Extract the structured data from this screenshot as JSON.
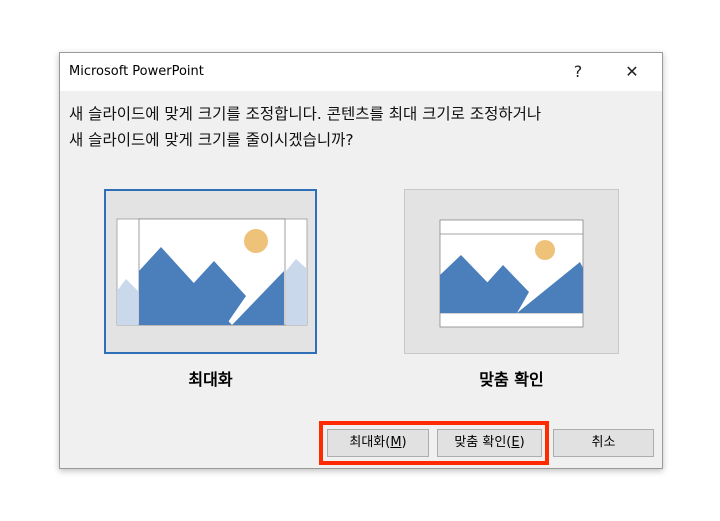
{
  "dialog": {
    "title": "Microsoft PowerPoint",
    "help_label": "?",
    "close_label": "✕",
    "message_line1": "새 슬라이드에 맞게 크기를 조정합니다. 콘텐츠를 최대 크기로 조정하거나",
    "message_line2": "새 슬라이드에 맞게 크기를 줄이시겠습니까?"
  },
  "options": [
    {
      "label": "최대화",
      "selected": true
    },
    {
      "label": "맞춤 확인",
      "selected": false
    }
  ],
  "buttons": {
    "maximize": "최대화(M)",
    "maximize_text": "최대화(",
    "maximize_key": "M",
    "ensure_fit_text": "맞춤 확인(",
    "ensure_fit_key": "E",
    "ensure_fit": "맞춤 확인(E)",
    "cancel": "취소"
  },
  "colors": {
    "accent": "#2f6fb8",
    "highlight": "#ff2a00",
    "mountain": "#4a7fbb",
    "sun": "#efc27a"
  }
}
